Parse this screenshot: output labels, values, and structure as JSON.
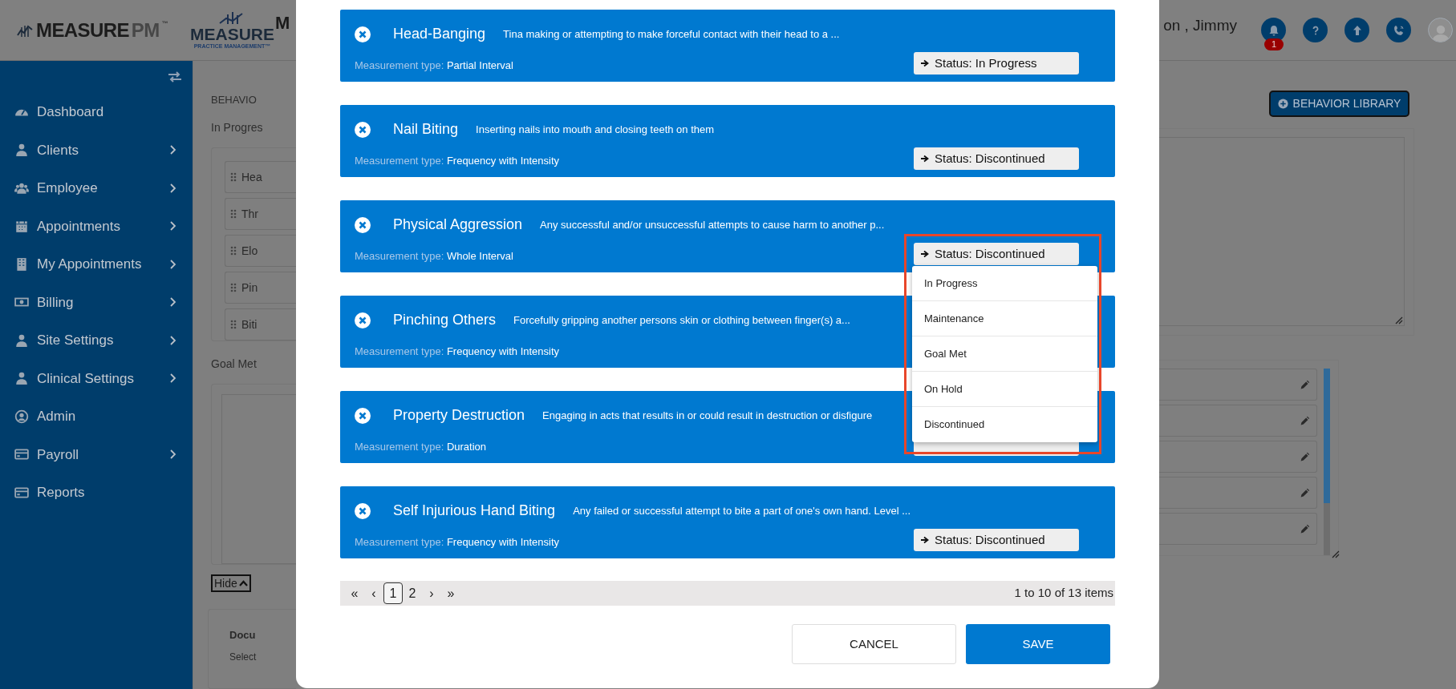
{
  "header": {
    "logo": {
      "main": "MEASURE",
      "accent": "PM",
      "mark": "™"
    },
    "brand": {
      "name": "MEASURE",
      "tagline": "PRACTICE MANAGEMENT™"
    },
    "page_title": "M",
    "user_name": "on , Jimmy",
    "notification_count": "1"
  },
  "sidebar": {
    "items": [
      {
        "label": "Dashboard",
        "has_submenu": false
      },
      {
        "label": "Clients",
        "has_submenu": true
      },
      {
        "label": "Employee",
        "has_submenu": true
      },
      {
        "label": "Appointments",
        "has_submenu": true
      },
      {
        "label": "My Appointments",
        "has_submenu": true
      },
      {
        "label": "Billing",
        "has_submenu": true
      },
      {
        "label": "Site Settings",
        "has_submenu": true
      },
      {
        "label": "Clinical Settings",
        "has_submenu": true
      },
      {
        "label": "Admin",
        "has_submenu": false
      },
      {
        "label": "Payroll",
        "has_submenu": true
      },
      {
        "label": "Reports",
        "has_submenu": false
      }
    ]
  },
  "background": {
    "section_label": "BEHAVIO",
    "in_progress_label": "In Progres",
    "in_progress_items": [
      "Hea",
      "Thr",
      "Elo",
      "Pin",
      "Biti"
    ],
    "goal_met_label": "Goal Met",
    "hide_button": "Hide",
    "library_button": "BEHAVIOR LIBRARY",
    "goal_met_rows": [
      {
        "editable": true
      },
      {
        "editable": true
      },
      {
        "editable": true
      },
      {
        "editable": true
      },
      {
        "editable": true
      }
    ],
    "document_card": {
      "title": "Docu",
      "hint": "Select"
    }
  },
  "modal": {
    "cards": [
      {
        "title": "Head-Banging",
        "description": "Tina making or attempting to make forceful contact with their head to a ...",
        "measurement_label": "Measurement type:",
        "measurement_type": "Partial Interval",
        "status": "Status: In Progress"
      },
      {
        "title": "Nail Biting",
        "description": "Inserting nails into mouth and closing teeth on them",
        "measurement_label": "Measurement type:",
        "measurement_type": "Frequency with Intensity",
        "status": "Status: Discontinued"
      },
      {
        "title": "Physical Aggression",
        "description": "Any successful and/or unsuccessful attempts to cause harm to another p...",
        "measurement_label": "Measurement type:",
        "measurement_type": "Whole Interval",
        "status": "Status: Discontinued",
        "menu": {
          "open": true,
          "highlighted": true,
          "options": [
            "In Progress",
            "Maintenance",
            "Goal Met",
            "On Hold",
            "Discontinued"
          ]
        }
      },
      {
        "title": "Pinching Others",
        "description": "Forcefully gripping another persons skin or clothing between finger(s) a...",
        "measurement_label": "Measurement type:",
        "measurement_type": "Frequency with Intensity"
      },
      {
        "title": "Property Destruction",
        "description": "Engaging in acts that results in or could result in destruction or disfigure",
        "measurement_label": "Measurement type:",
        "measurement_type": "Duration"
      },
      {
        "title": "Self Injurious Hand Biting",
        "description": "Any failed or successful attempt to bite a part of one's own hand. Level ...",
        "measurement_label": "Measurement type:",
        "measurement_type": "Frequency with Intensity",
        "status": "Status: Discontinued"
      }
    ],
    "pagination": {
      "first": "«",
      "prev": "‹",
      "pages": [
        {
          "label": "1",
          "selected": true
        },
        {
          "label": "2",
          "selected": false
        }
      ],
      "next": "›",
      "last": "»",
      "summary": "1 to 10 of 13 items"
    },
    "buttons": {
      "cancel": "CANCEL",
      "save": "SAVE"
    }
  }
}
